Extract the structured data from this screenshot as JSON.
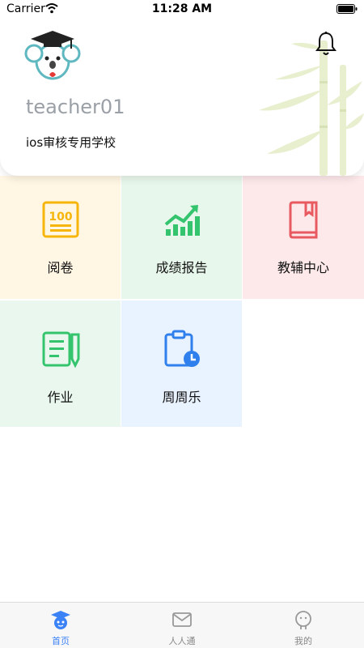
{
  "status_bar": {
    "carrier": "Carrier",
    "time": "11:28 AM"
  },
  "header": {
    "username": "teacher01",
    "school": "ios审核专用学校"
  },
  "tiles": [
    {
      "label": "阅卷",
      "icon": "score-100-icon"
    },
    {
      "label": "成绩报告",
      "icon": "trend-chart-icon"
    },
    {
      "label": "教辅中心",
      "icon": "book-icon"
    },
    {
      "label": "作业",
      "icon": "notebook-pen-icon"
    },
    {
      "label": "周周乐",
      "icon": "clipboard-clock-icon"
    }
  ],
  "tabbar": {
    "items": [
      {
        "label": "首页",
        "icon": "graduate-icon",
        "active": true
      },
      {
        "label": "人人通",
        "icon": "mail-icon",
        "active": false
      },
      {
        "label": "我的",
        "icon": "profile-icon",
        "active": false
      }
    ]
  },
  "colors": {
    "accent": "#3b82f6",
    "yellow": "#f5b50a",
    "green": "#33c46d",
    "red": "#e85a5f",
    "blue": "#2f80ed"
  }
}
